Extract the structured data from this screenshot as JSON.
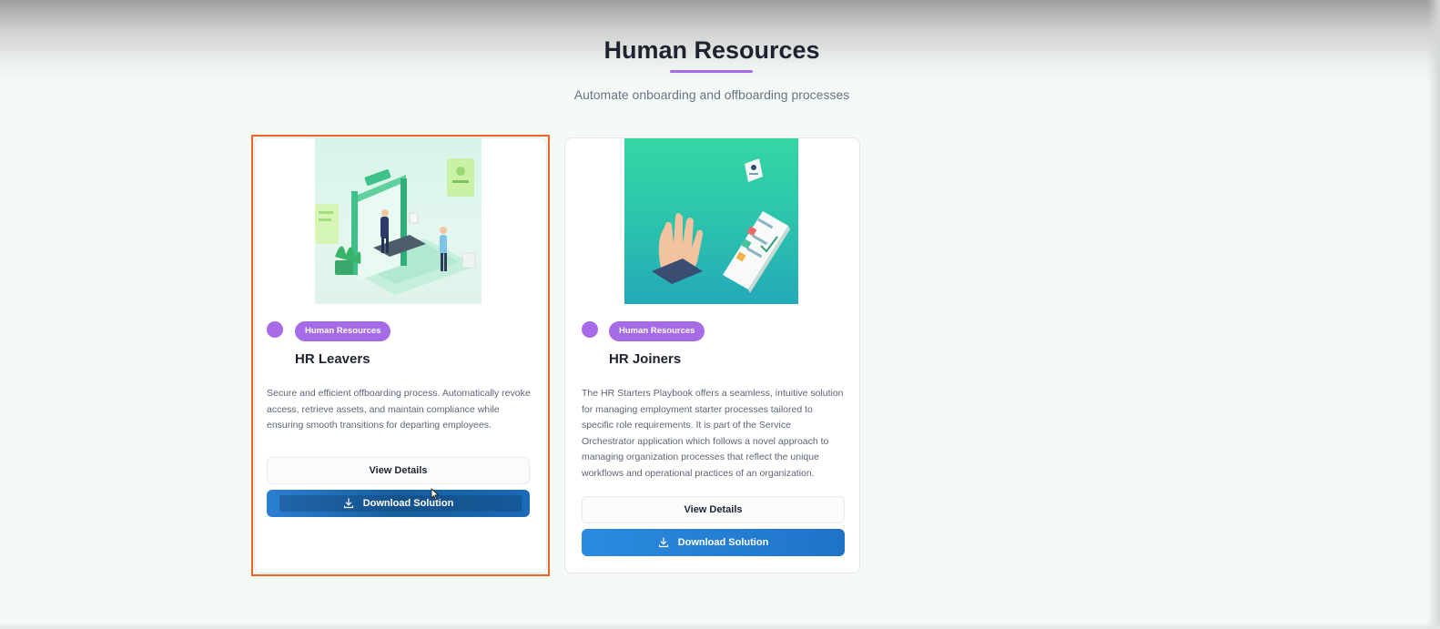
{
  "section": {
    "title": "Human Resources",
    "subtitle": "Automate onboarding and offboarding processes",
    "accent_color": "#a66be6"
  },
  "cards": [
    {
      "badge": "Human Resources",
      "title": "HR Leavers",
      "description": "Secure and efficient offboarding process. Automatically revoke access, retrieve assets, and maintain compliance while ensuring smooth transitions for departing employees.",
      "view_label": "View Details",
      "download_label": "Download Solution",
      "download_icon": "download-icon",
      "highlighted": true
    },
    {
      "badge": "Human Resources",
      "title": "HR Joiners",
      "description": "The HR Starters Playbook offers a seamless, intuitive solution for managing employment starter processes tailored to specific role requirements. It is part of the Service Orchestrator application which follows a novel approach to managing organization processes that reflect the unique workflows and operational practices of an organization.",
      "view_label": "View Details",
      "download_label": "Download Solution",
      "download_icon": "download-icon",
      "highlighted": false
    }
  ],
  "colors": {
    "badge": "#a66be6",
    "button_primary": "#2a8be0",
    "highlight_border": "#ef6421"
  }
}
